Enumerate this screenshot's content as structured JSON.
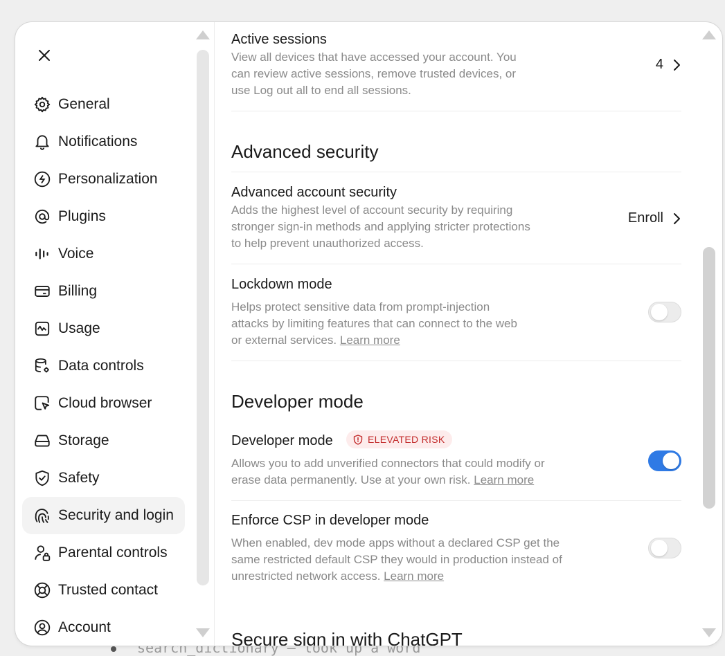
{
  "background": {
    "snippet_code": "search_dictionary",
    "snippet_text": " — look up a word"
  },
  "colors": {
    "accent": "#2f7ae5",
    "risk_text": "#c22a2a",
    "risk_bg": "#fdecec",
    "muted": "#8a8a8a"
  },
  "sidebar": {
    "close_icon": "close-icon",
    "items": [
      {
        "label": "General",
        "icon": "gear-icon"
      },
      {
        "label": "Notifications",
        "icon": "bell-icon"
      },
      {
        "label": "Personalization",
        "icon": "personalization-icon"
      },
      {
        "label": "Plugins",
        "icon": "at-plugin-icon"
      },
      {
        "label": "Voice",
        "icon": "voice-wave-icon"
      },
      {
        "label": "Billing",
        "icon": "card-icon"
      },
      {
        "label": "Usage",
        "icon": "activity-chart-icon"
      },
      {
        "label": "Data controls",
        "icon": "database-gear-icon"
      },
      {
        "label": "Cloud browser",
        "icon": "browser-cursor-icon"
      },
      {
        "label": "Storage",
        "icon": "hard-drive-icon"
      },
      {
        "label": "Safety",
        "icon": "shield-check-icon"
      },
      {
        "label": "Security and login",
        "icon": "key-fingerprint-icon",
        "active": true
      },
      {
        "label": "Parental controls",
        "icon": "user-lock-icon"
      },
      {
        "label": "Trusted contact",
        "icon": "lifebuoy-icon"
      },
      {
        "label": "Account",
        "icon": "user-circle-icon"
      }
    ]
  },
  "main": {
    "active_sessions": {
      "title": "Active sessions",
      "desc": "View all devices that have accessed your account. You can review active sessions, remove trusted devices, or use Log out all to end all sessions.",
      "count": "4"
    },
    "advanced_security": {
      "heading": "Advanced security",
      "account_security": {
        "title": "Advanced account security",
        "desc": "Adds the highest level of account security by requiring stronger sign-in methods and applying stricter protections to help prevent unauthorized access.",
        "action": "Enroll"
      },
      "lockdown": {
        "title": "Lockdown mode",
        "desc": "Helps protect sensitive data from prompt-injection attacks by limiting features that can connect to the web or external services.",
        "learn_more": "Learn more",
        "enabled": false
      }
    },
    "developer_mode": {
      "heading": "Developer mode",
      "toggle_row": {
        "title": "Developer mode",
        "badge": "ELEVATED RISK",
        "desc": "Allows you to add unverified connectors that could modify or erase data permanently. Use at your own risk.",
        "learn_more": "Learn more",
        "enabled": true
      },
      "csp": {
        "title": "Enforce CSP in developer mode",
        "desc": "When enabled, dev mode apps without a declared CSP get the same restricted default CSP they would in production instead of unrestricted network access.",
        "learn_more": "Learn more",
        "enabled": false
      }
    },
    "next_heading": "Secure sign in with ChatGPT"
  }
}
